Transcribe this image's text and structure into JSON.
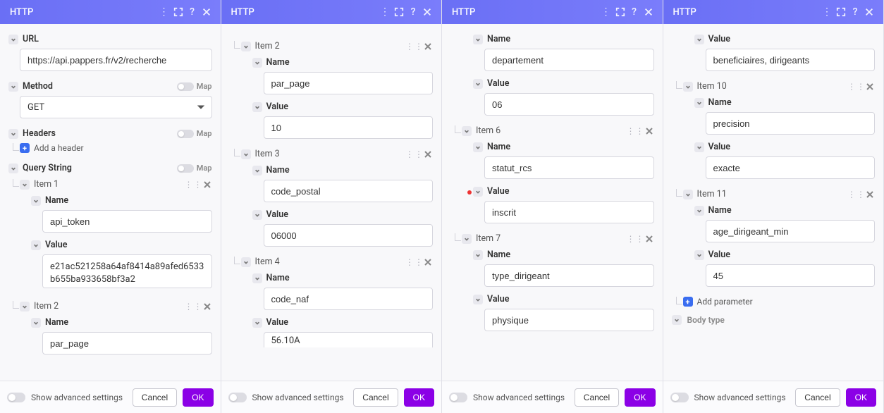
{
  "header": {
    "title": "HTTP"
  },
  "footer": {
    "advanced_label": "Show advanced settings",
    "cancel_label": "Cancel",
    "ok_label": "OK"
  },
  "labels": {
    "url": "URL",
    "method": "Method",
    "headers": "Headers",
    "query_string": "Query String",
    "add_header": "Add a header",
    "add_parameter": "Add parameter",
    "map": "Map",
    "name": "Name",
    "value": "Value",
    "body_type": "Body type"
  },
  "url_value": "https://api.pappers.fr/v2/recherche",
  "method_value": "GET",
  "items": {
    "i1": {
      "label": "Item 1",
      "name": "api_token",
      "value": "e21ac521258a64af8414a89afed6533b655ba933658bf3a2"
    },
    "i2": {
      "label": "Item 2",
      "name": "par_page",
      "value": "10"
    },
    "i3": {
      "label": "Item 3",
      "name": "code_postal",
      "value": "06000"
    },
    "i4": {
      "label": "Item 4",
      "name": "code_naf",
      "value": "56.10A"
    },
    "i5_name_label": "Name",
    "i5_name": "departement",
    "i5_value": "06",
    "i6": {
      "label": "Item 6",
      "name": "statut_rcs",
      "value": "inscrit"
    },
    "i7": {
      "label": "Item 7",
      "name": "type_dirigeant",
      "value": "physique"
    },
    "i9_value": "beneficiaires, dirigeants",
    "i10": {
      "label": "Item 10",
      "name": "precision",
      "value": "exacte"
    },
    "i11": {
      "label": "Item 11",
      "name": "age_dirigeant_min",
      "value": "45"
    },
    "p1_i2": {
      "label": "Item 2",
      "name": "par_page"
    }
  }
}
